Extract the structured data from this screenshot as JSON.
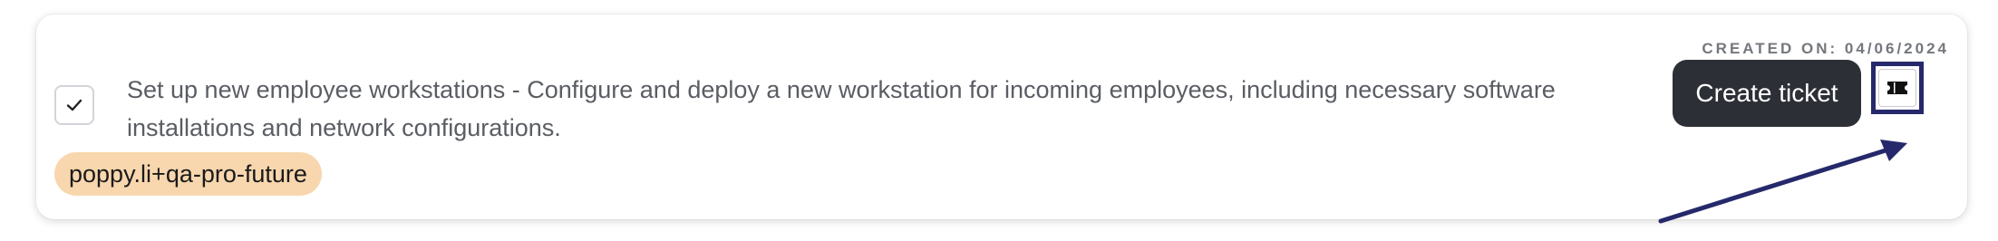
{
  "task": {
    "description": "Set up new employee workstations - Configure and deploy a new workstation for incoming employees, including necessary software installations and network configurations.",
    "checked": true,
    "tag": "poppy.li+qa-pro-future",
    "created_on": "CREATED ON: 04/06/2024"
  },
  "tooltip": {
    "label": "Create ticket"
  },
  "icons": {
    "checkbox": "check-icon",
    "ticket": "ticket-icon"
  },
  "colors": {
    "tag_bg": "#f8d7ae",
    "tooltip_bg": "#2d2f36",
    "highlight": "#25296b"
  }
}
